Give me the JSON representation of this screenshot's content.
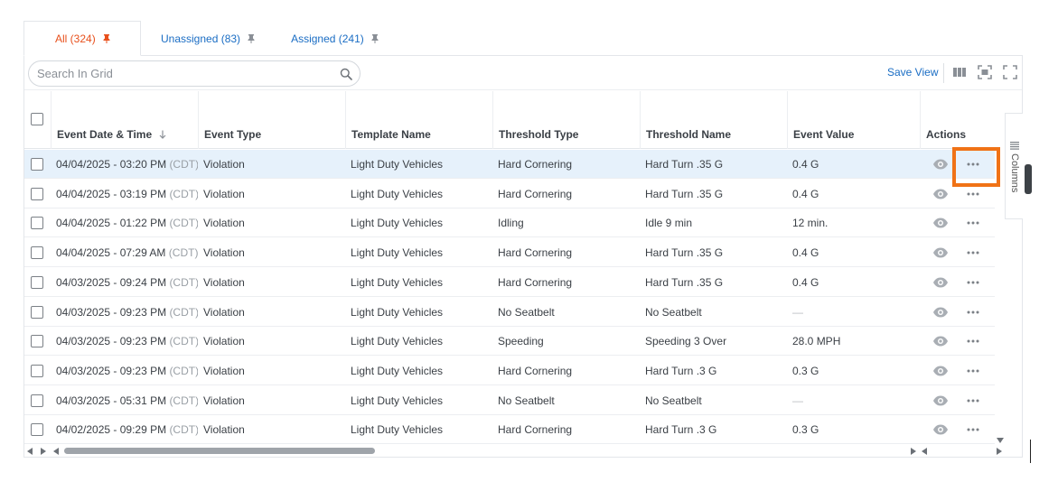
{
  "tabs": [
    {
      "label": "All (324)",
      "active": true
    },
    {
      "label": "Unassigned (83)",
      "active": false
    },
    {
      "label": "Assigned (241)",
      "active": false
    }
  ],
  "toolbar": {
    "search_placeholder": "Search In Grid",
    "save_view_label": "Save View"
  },
  "columns": {
    "event_datetime": "Event Date & Time",
    "event_type": "Event Type",
    "template_name": "Template Name",
    "threshold_type": "Threshold Type",
    "threshold_name": "Threshold Name",
    "event_value": "Event Value",
    "actions": "Actions"
  },
  "side_panel": {
    "label": "Columns"
  },
  "rows": [
    {
      "date": "04/04/2025 - 03:20 PM",
      "tz": "(CDT)",
      "event_type": "Violation",
      "template": "Light Duty Vehicles",
      "threshold_type": "Hard Cornering",
      "threshold_name": "Hard Turn .35 G",
      "value": "0.4 G"
    },
    {
      "date": "04/04/2025 - 03:19 PM",
      "tz": "(CDT)",
      "event_type": "Violation",
      "template": "Light Duty Vehicles",
      "threshold_type": "Hard Cornering",
      "threshold_name": "Hard Turn .35 G",
      "value": "0.4 G"
    },
    {
      "date": "04/04/2025 - 01:22 PM",
      "tz": "(CDT)",
      "event_type": "Violation",
      "template": "Light Duty Vehicles",
      "threshold_type": "Idling",
      "threshold_name": "Idle 9 min",
      "value": "12 min."
    },
    {
      "date": "04/04/2025 - 07:29 AM",
      "tz": "(CDT)",
      "event_type": "Violation",
      "template": "Light Duty Vehicles",
      "threshold_type": "Hard Cornering",
      "threshold_name": "Hard Turn .35 G",
      "value": "0.4 G"
    },
    {
      "date": "04/03/2025 - 09:24 PM",
      "tz": "(CDT)",
      "event_type": "Violation",
      "template": "Light Duty Vehicles",
      "threshold_type": "Hard Cornering",
      "threshold_name": "Hard Turn .35 G",
      "value": "0.4 G"
    },
    {
      "date": "04/03/2025 - 09:23 PM",
      "tz": "(CDT)",
      "event_type": "Violation",
      "template": "Light Duty Vehicles",
      "threshold_type": "No Seatbelt",
      "threshold_name": "No Seatbelt",
      "value": "—"
    },
    {
      "date": "04/03/2025 - 09:23 PM",
      "tz": "(CDT)",
      "event_type": "Violation",
      "template": "Light Duty Vehicles",
      "threshold_type": "Speeding",
      "threshold_name": "Speeding 3 Over",
      "value": "28.0 MPH"
    },
    {
      "date": "04/03/2025 - 09:23 PM",
      "tz": "(CDT)",
      "event_type": "Violation",
      "template": "Light Duty Vehicles",
      "threshold_type": "Hard Cornering",
      "threshold_name": "Hard Turn .3 G",
      "value": "0.3 G"
    },
    {
      "date": "04/03/2025 - 05:31 PM",
      "tz": "(CDT)",
      "event_type": "Violation",
      "template": "Light Duty Vehicles",
      "threshold_type": "No Seatbelt",
      "threshold_name": "No Seatbelt",
      "value": "—"
    },
    {
      "date": "04/02/2025 - 09:29 PM",
      "tz": "(CDT)",
      "event_type": "Violation",
      "template": "Light Duty Vehicles",
      "threshold_type": "Hard Cornering",
      "threshold_name": "Hard Turn .3 G",
      "value": "0.3 G"
    }
  ],
  "colors": {
    "accent_active_tab": "#e8501c",
    "link_blue": "#1a6dc4",
    "selected_row": "#e6f1fb",
    "highlight_box": "#f07216"
  }
}
